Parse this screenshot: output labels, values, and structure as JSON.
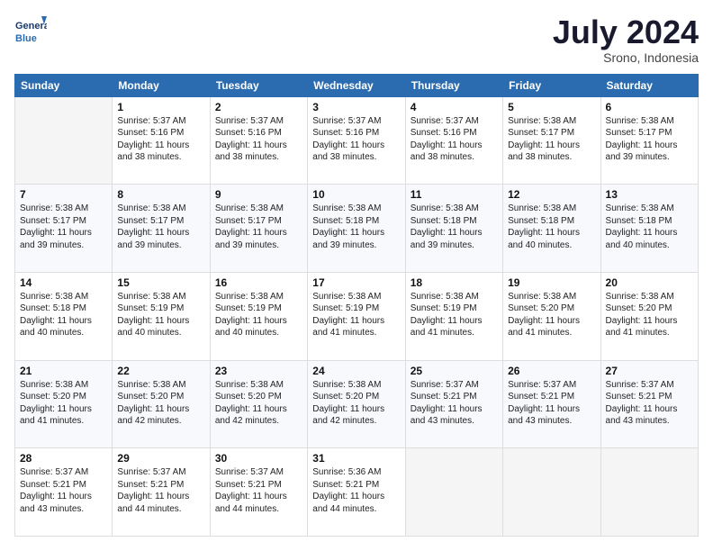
{
  "logo": {
    "line1": "General",
    "line2": "Blue"
  },
  "title": "July 2024",
  "subtitle": "Srono, Indonesia",
  "days_of_week": [
    "Sunday",
    "Monday",
    "Tuesday",
    "Wednesday",
    "Thursday",
    "Friday",
    "Saturday"
  ],
  "weeks": [
    [
      {
        "day": "",
        "info": ""
      },
      {
        "day": "1",
        "info": "Sunrise: 5:37 AM\nSunset: 5:16 PM\nDaylight: 11 hours\nand 38 minutes."
      },
      {
        "day": "2",
        "info": "Sunrise: 5:37 AM\nSunset: 5:16 PM\nDaylight: 11 hours\nand 38 minutes."
      },
      {
        "day": "3",
        "info": "Sunrise: 5:37 AM\nSunset: 5:16 PM\nDaylight: 11 hours\nand 38 minutes."
      },
      {
        "day": "4",
        "info": "Sunrise: 5:37 AM\nSunset: 5:16 PM\nDaylight: 11 hours\nand 38 minutes."
      },
      {
        "day": "5",
        "info": "Sunrise: 5:38 AM\nSunset: 5:17 PM\nDaylight: 11 hours\nand 38 minutes."
      },
      {
        "day": "6",
        "info": "Sunrise: 5:38 AM\nSunset: 5:17 PM\nDaylight: 11 hours\nand 39 minutes."
      }
    ],
    [
      {
        "day": "7",
        "info": ""
      },
      {
        "day": "8",
        "info": "Sunrise: 5:38 AM\nSunset: 5:17 PM\nDaylight: 11 hours\nand 39 minutes."
      },
      {
        "day": "9",
        "info": "Sunrise: 5:38 AM\nSunset: 5:17 PM\nDaylight: 11 hours\nand 39 minutes."
      },
      {
        "day": "10",
        "info": "Sunrise: 5:38 AM\nSunset: 5:18 PM\nDaylight: 11 hours\nand 39 minutes."
      },
      {
        "day": "11",
        "info": "Sunrise: 5:38 AM\nSunset: 5:18 PM\nDaylight: 11 hours\nand 39 minutes."
      },
      {
        "day": "12",
        "info": "Sunrise: 5:38 AM\nSunset: 5:18 PM\nDaylight: 11 hours\nand 40 minutes."
      },
      {
        "day": "13",
        "info": "Sunrise: 5:38 AM\nSunset: 5:18 PM\nDaylight: 11 hours\nand 40 minutes."
      }
    ],
    [
      {
        "day": "14",
        "info": ""
      },
      {
        "day": "15",
        "info": "Sunrise: 5:38 AM\nSunset: 5:19 PM\nDaylight: 11 hours\nand 40 minutes."
      },
      {
        "day": "16",
        "info": "Sunrise: 5:38 AM\nSunset: 5:19 PM\nDaylight: 11 hours\nand 40 minutes."
      },
      {
        "day": "17",
        "info": "Sunrise: 5:38 AM\nSunset: 5:19 PM\nDaylight: 11 hours\nand 41 minutes."
      },
      {
        "day": "18",
        "info": "Sunrise: 5:38 AM\nSunset: 5:19 PM\nDaylight: 11 hours\nand 41 minutes."
      },
      {
        "day": "19",
        "info": "Sunrise: 5:38 AM\nSunset: 5:20 PM\nDaylight: 11 hours\nand 41 minutes."
      },
      {
        "day": "20",
        "info": "Sunrise: 5:38 AM\nSunset: 5:20 PM\nDaylight: 11 hours\nand 41 minutes."
      }
    ],
    [
      {
        "day": "21",
        "info": ""
      },
      {
        "day": "22",
        "info": "Sunrise: 5:38 AM\nSunset: 5:20 PM\nDaylight: 11 hours\nand 42 minutes."
      },
      {
        "day": "23",
        "info": "Sunrise: 5:38 AM\nSunset: 5:20 PM\nDaylight: 11 hours\nand 42 minutes."
      },
      {
        "day": "24",
        "info": "Sunrise: 5:38 AM\nSunset: 5:20 PM\nDaylight: 11 hours\nand 42 minutes."
      },
      {
        "day": "25",
        "info": "Sunrise: 5:37 AM\nSunset: 5:21 PM\nDaylight: 11 hours\nand 43 minutes."
      },
      {
        "day": "26",
        "info": "Sunrise: 5:37 AM\nSunset: 5:21 PM\nDaylight: 11 hours\nand 43 minutes."
      },
      {
        "day": "27",
        "info": "Sunrise: 5:37 AM\nSunset: 5:21 PM\nDaylight: 11 hours\nand 43 minutes."
      }
    ],
    [
      {
        "day": "28",
        "info": "Sunrise: 5:37 AM\nSunset: 5:21 PM\nDaylight: 11 hours\nand 43 minutes."
      },
      {
        "day": "29",
        "info": "Sunrise: 5:37 AM\nSunset: 5:21 PM\nDaylight: 11 hours\nand 44 minutes."
      },
      {
        "day": "30",
        "info": "Sunrise: 5:37 AM\nSunset: 5:21 PM\nDaylight: 11 hours\nand 44 minutes."
      },
      {
        "day": "31",
        "info": "Sunrise: 5:36 AM\nSunset: 5:21 PM\nDaylight: 11 hours\nand 44 minutes."
      },
      {
        "day": "",
        "info": ""
      },
      {
        "day": "",
        "info": ""
      },
      {
        "day": "",
        "info": ""
      }
    ]
  ],
  "week1_day7_info": "Sunrise: 5:38 AM\nSunset: 5:17 PM\nDaylight: 11 hours\nand 39 minutes.",
  "week2_day14_info": "Sunrise: 5:38 AM\nSunset: 5:18 PM\nDaylight: 11 hours\nand 40 minutes.",
  "week3_day21_info": "Sunrise: 5:38 AM\nSunset: 5:20 PM\nDaylight: 11 hours\nand 41 minutes."
}
